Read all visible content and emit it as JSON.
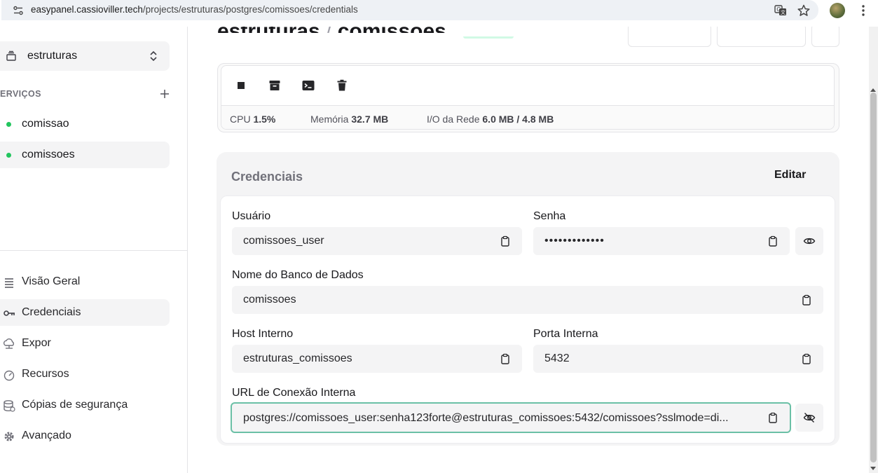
{
  "browser": {
    "url_host": "easypanel.cassioviller.tech",
    "url_path": "/projects/estruturas/postgres/comissoes/credentials"
  },
  "sidebar": {
    "project": "estruturas",
    "services_label": "ERVIÇOS",
    "services": [
      {
        "label": "comissao",
        "status_color": "#22c55e"
      },
      {
        "label": "comissoes",
        "status_color": "#22c55e"
      }
    ],
    "nav": [
      {
        "label": "Visão Geral",
        "icon": "list-icon"
      },
      {
        "label": "Credenciais",
        "icon": "key-icon"
      },
      {
        "label": "Expor",
        "icon": "cloud-icon"
      },
      {
        "label": "Recursos",
        "icon": "gauge-icon"
      },
      {
        "label": "Cópias de segurança",
        "icon": "database-icon"
      },
      {
        "label": "Avançado",
        "icon": "gear-icon"
      }
    ]
  },
  "header": {
    "project": "estruturas",
    "separator": "/",
    "service": "comissoes"
  },
  "stats": {
    "cpu_label": "CPU",
    "cpu_value": "1.5%",
    "mem_label": "Memória",
    "mem_value": "32.7 MB",
    "net_label": "I/O da Rede",
    "net_value": "6.0 MB / 4.8 MB"
  },
  "credentials": {
    "title": "Credenciais",
    "edit_label": "Editar",
    "user_label": "Usuário",
    "user_value": "comissoes_user",
    "password_label": "Senha",
    "password_value": "•••••••••••••",
    "dbname_label": "Nome do Banco de Dados",
    "dbname_value": "comissoes",
    "host_label": "Host Interno",
    "host_value": "estruturas_comissoes",
    "port_label": "Porta Interna",
    "port_value": "5432",
    "url_label": "URL de Conexão Interna",
    "url_value": "postgres://comissoes_user:senha123forte@estruturas_comissoes:5432/comissoes?sslmode=di..."
  },
  "colors": {
    "accent_focus": "#6bc0a6",
    "status_green": "#22c55e"
  }
}
